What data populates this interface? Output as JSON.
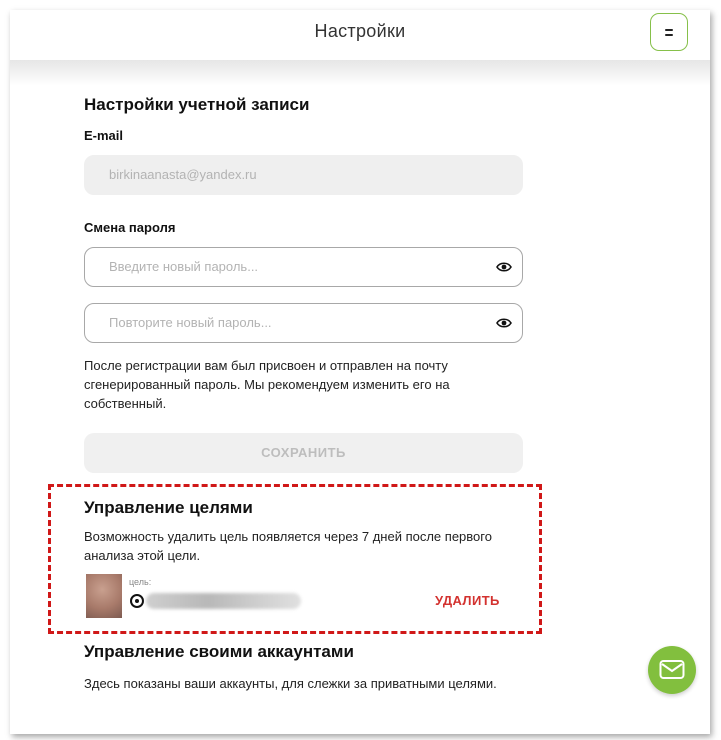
{
  "header": {
    "title": "Настройки"
  },
  "account": {
    "heading": "Настройки учетной записи",
    "email_label": "E-mail",
    "email_value": "birkinaanasta@yandex.ru",
    "password_label": "Смена пароля",
    "new_password_placeholder": "Введите новый пароль...",
    "repeat_password_placeholder": "Повторите новый пароль...",
    "note": "После регистрации вам был присвоен и отправлен на почту сгенерированный пароль. Мы рекомендуем изменить его на собственный.",
    "save_label": "СОХРАНИТЬ"
  },
  "goals": {
    "heading": "Управление целями",
    "description": "Возможность удалить цель появляется через 7 дней после первого анализа этой цели.",
    "goal_caption": "цель:",
    "delete_label": "УДАЛИТЬ"
  },
  "accounts": {
    "heading": "Управление своими аккаунтами",
    "description": "Здесь показаны ваши аккаунты, для слежки за приватными целями."
  },
  "icons": {
    "menu": "menu-icon",
    "eye": "eye-icon",
    "goal": "instagram-icon",
    "mail": "mail-icon"
  },
  "colors": {
    "accent_green": "#82bf3e",
    "danger_red": "#d3322f",
    "highlight_red": "#d01818"
  }
}
